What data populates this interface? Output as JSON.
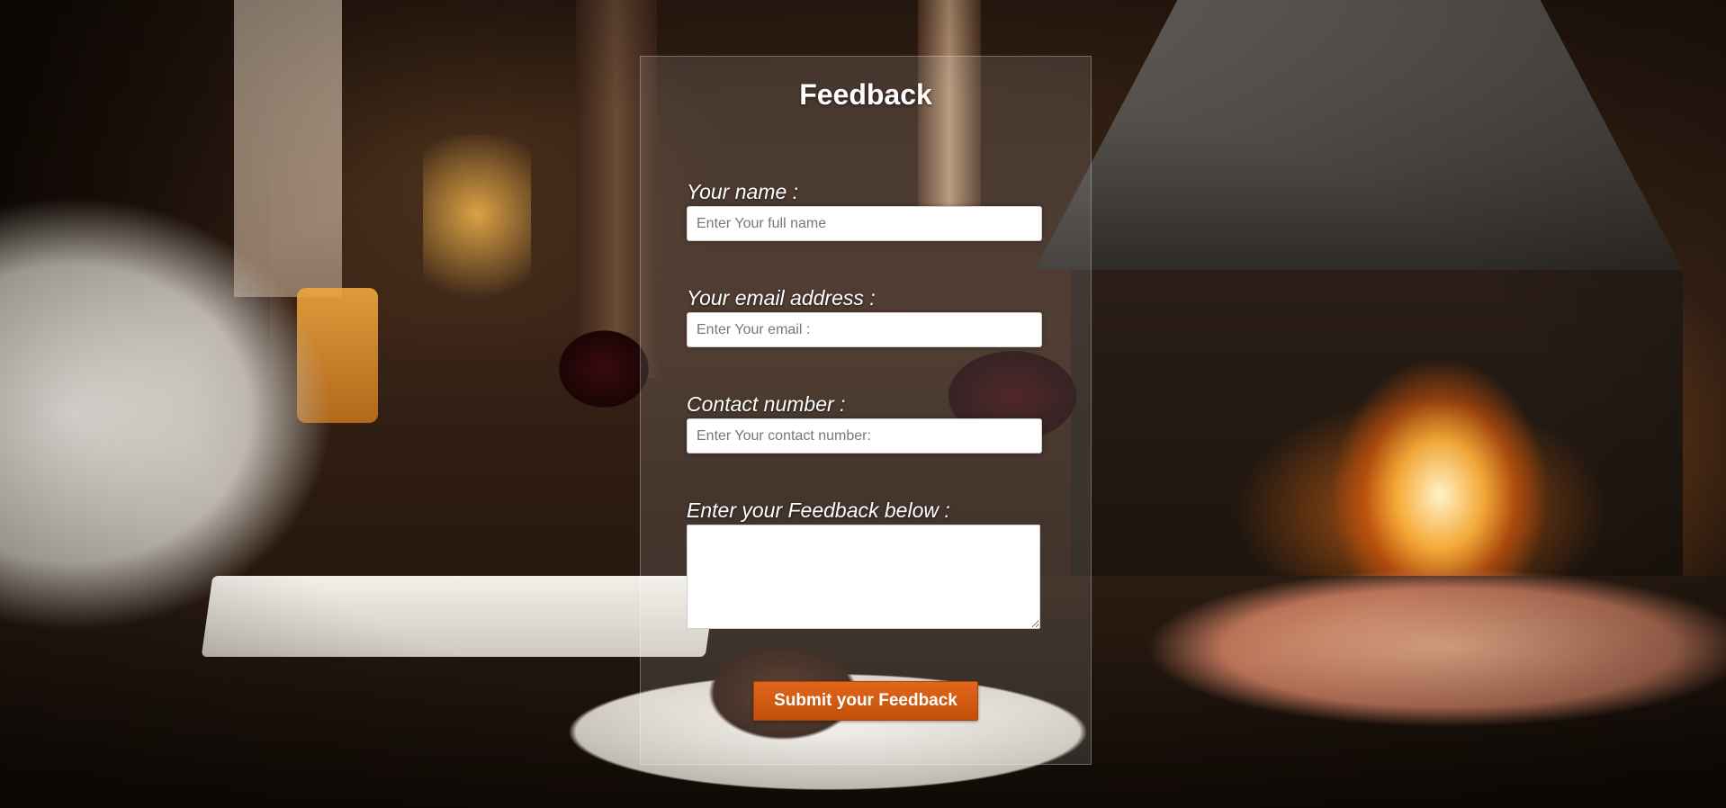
{
  "form": {
    "title": "Feedback",
    "fields": [
      {
        "label": "Your name :",
        "placeholder": "Enter Your full name",
        "value": ""
      },
      {
        "label": "Your email address :",
        "placeholder": "Enter Your email :",
        "value": ""
      },
      {
        "label": "Contact number :",
        "placeholder": "Enter Your contact number:",
        "value": ""
      }
    ],
    "feedback": {
      "label": "Enter your Feedback below :",
      "value": ""
    },
    "submit_label": "Submit your Feedback"
  },
  "colors": {
    "accent": "#d35a12",
    "panel_background": "rgba(255,255,255,0.12)",
    "label_text": "#ffffff"
  }
}
